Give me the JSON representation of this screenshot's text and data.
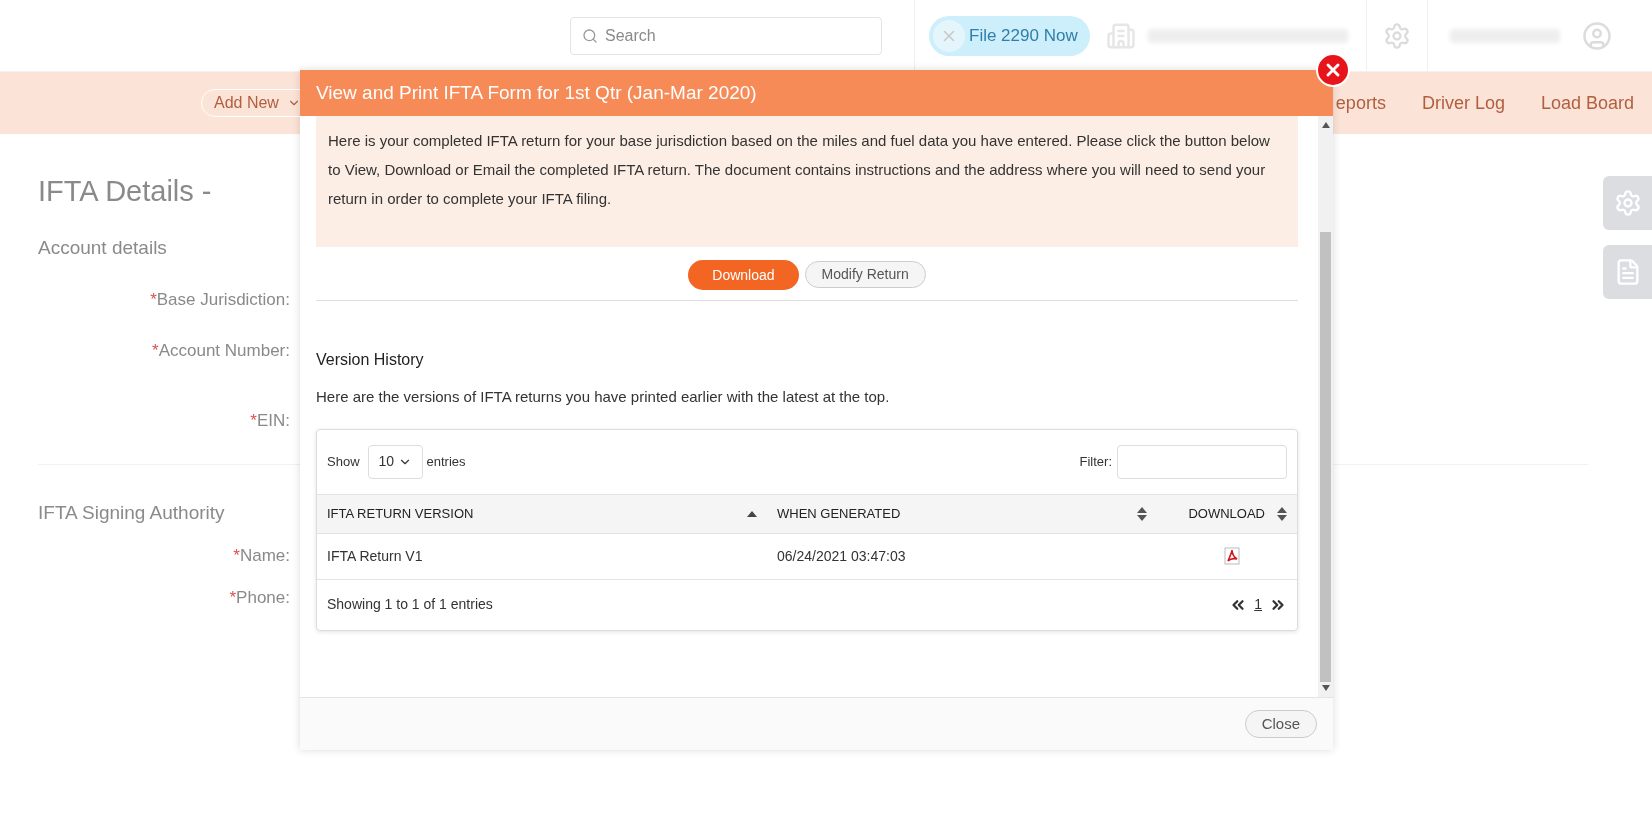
{
  "header": {
    "search": {
      "placeholder": "Search"
    },
    "file_button": {
      "label": "File 2290 Now"
    }
  },
  "nav": {
    "add_new": "Add New",
    "items": [
      "eports",
      "Driver Log",
      "Load Board"
    ]
  },
  "page": {
    "title": "IFTA Details -",
    "sections": [
      {
        "heading": "Account details",
        "fields": [
          "Base Jurisdiction:",
          "Account Number:",
          "EIN:"
        ]
      },
      {
        "heading": "IFTA Signing Authority",
        "fields": [
          "Name:",
          "Phone:"
        ]
      }
    ],
    "required_mark": "*"
  },
  "modal": {
    "title": "View and Print IFTA Form for 1st Qtr (Jan-Mar 2020)",
    "intro": "Here is your completed IFTA return for your base jurisdiction based on the miles and fuel data you have entered. Please click the button below to View, Download or Email the completed IFTA return. The document contains instructions and the address where you will need to send your return in order to complete your IFTA filing.",
    "buttons": [
      {
        "label": "Download",
        "kind": "primary"
      },
      {
        "label": "Modify Return",
        "kind": "secondary"
      }
    ],
    "history_title": "Version History",
    "history_desc": "Here are the versions of IFTA returns you have printed earlier with the latest at the top.",
    "table": {
      "show_label": "Show",
      "entries_value": "10",
      "entries_label": "entries",
      "filter_label": "Filter:",
      "columns": [
        {
          "label": "IFTA RETURN VERSION",
          "sorted": true
        },
        {
          "label": "WHEN GENERATED",
          "sorted": false
        },
        {
          "label": "DOWNLOAD",
          "sorted": false
        }
      ],
      "rows": [
        {
          "version": "IFTA Return V1",
          "generated": "06/24/2021 03:47:03"
        }
      ],
      "info": "Showing 1 to 1 of 1 entries",
      "pages": [
        {
          "label": "1",
          "selected": true
        }
      ]
    },
    "close": "Close"
  }
}
